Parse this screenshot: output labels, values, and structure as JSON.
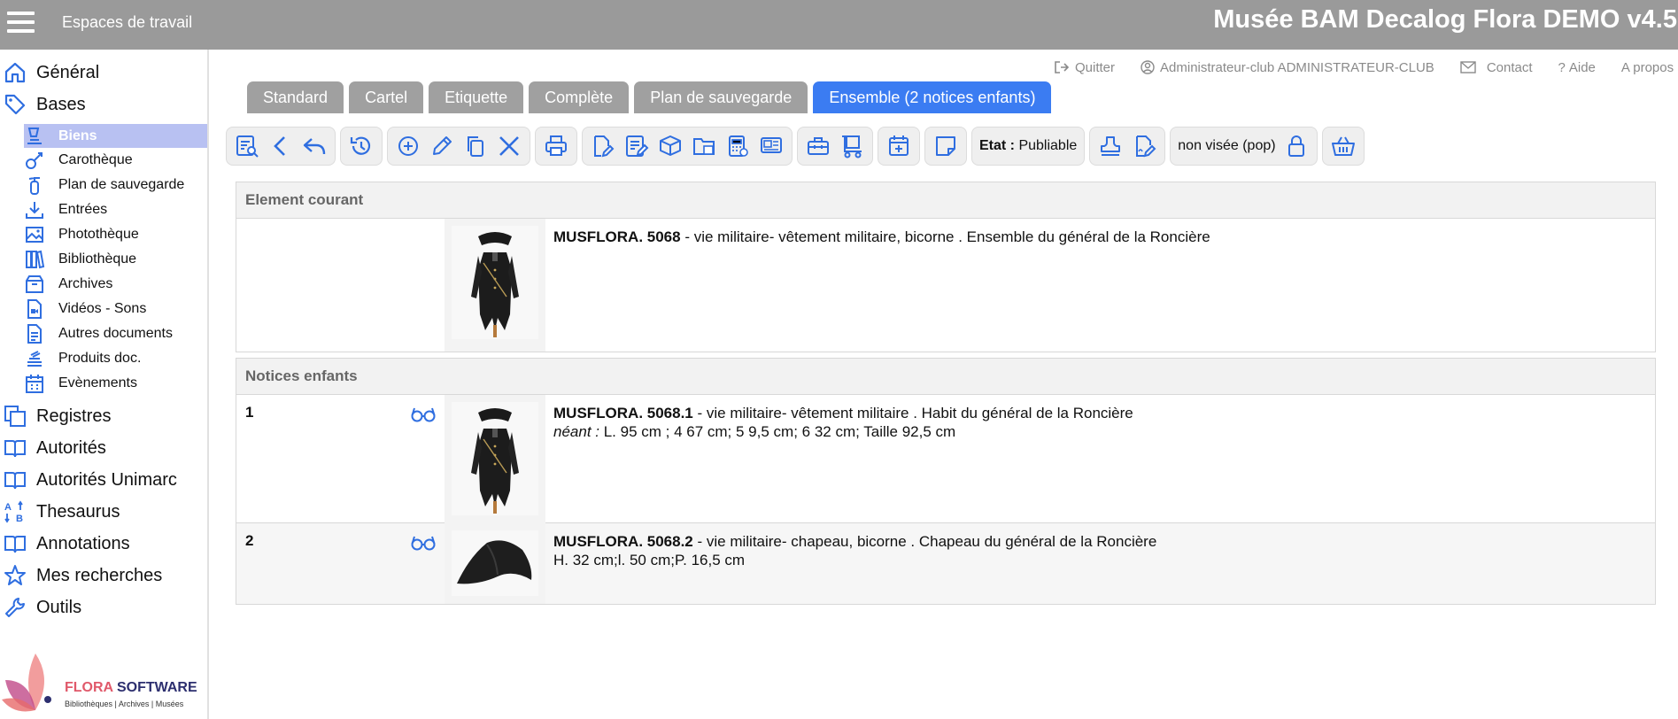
{
  "topbar": {
    "workspaces_label": "Espaces de travail",
    "app_title": "Musée BAM Decalog Flora DEMO v4.5"
  },
  "sidebar": {
    "top_items": [
      {
        "label": "Général",
        "icon": "home-icon"
      },
      {
        "label": "Bases",
        "icon": "tag-icon"
      }
    ],
    "sub_items": [
      {
        "label": "Biens",
        "icon": "biens-icon",
        "active": true
      },
      {
        "label": "Carothèque",
        "icon": "carotheque-icon"
      },
      {
        "label": "Plan de sauvegarde",
        "icon": "extinguisher-icon"
      },
      {
        "label": "Entrées",
        "icon": "download-icon"
      },
      {
        "label": "Photothèque",
        "icon": "images-icon"
      },
      {
        "label": "Bibliothèque",
        "icon": "books-icon"
      },
      {
        "label": "Archives",
        "icon": "archive-box-icon"
      },
      {
        "label": "Vidéos - Sons",
        "icon": "video-file-icon"
      },
      {
        "label": "Autres documents",
        "icon": "document-icon"
      },
      {
        "label": "Produits doc.",
        "icon": "stack-icon"
      },
      {
        "label": "Evènements",
        "icon": "calendar-icon"
      }
    ],
    "bottom_items": [
      {
        "label": "Registres",
        "icon": "registers-icon"
      },
      {
        "label": "Autorités",
        "icon": "book-open-icon"
      },
      {
        "label": "Autorités Unimarc",
        "icon": "book-open-icon"
      },
      {
        "label": "Thesaurus",
        "icon": "sort-az-icon"
      },
      {
        "label": "Annotations",
        "icon": "book-open-icon"
      },
      {
        "label": "Mes recherches",
        "icon": "star-icon"
      },
      {
        "label": "Outils",
        "icon": "wrench-icon"
      }
    ],
    "logo": {
      "brand_part1": "FLORA",
      "brand_part2": "SOFTWARE",
      "tagline": "Bibliothèques | Archives | Musées"
    }
  },
  "header_links": {
    "quit": "Quitter",
    "user": "Administrateur-club ADMINISTRATEUR-CLUB",
    "contact": "Contact",
    "help": "Aide",
    "about": "A propos"
  },
  "tabs": [
    {
      "label": "Standard"
    },
    {
      "label": "Cartel"
    },
    {
      "label": "Etiquette"
    },
    {
      "label": "Complète"
    },
    {
      "label": "Plan de sauvegarde"
    },
    {
      "label": "Ensemble (2 notices enfants)",
      "active": true
    }
  ],
  "toolbar": {
    "etat_label": "Etat :",
    "etat_value": "Publiable",
    "visa_status": "non visée (pop)"
  },
  "current_element": {
    "header": "Element courant",
    "record_id": "MUSFLORA. 5068",
    "description": " - vie militaire- vêtement militaire, bicorne . Ensemble du général de la Roncière"
  },
  "children": {
    "header": "Notices enfants",
    "rows": [
      {
        "num": "1",
        "record_id": "MUSFLORA. 5068.1",
        "description": " - vie militaire- vêtement militaire . Habit du général de la Roncière",
        "dims_label": "néant :",
        "dims": " L. 95 cm ; 4 67 cm; 5 9,5 cm; 6 32 cm; Taille 92,5 cm"
      },
      {
        "num": "2",
        "record_id": "MUSFLORA. 5068.2",
        "description": " - vie militaire- chapeau, bicorne . Chapeau du général de la Roncière",
        "dims": "H. 32 cm;l. 50 cm;P. 16,5 cm"
      }
    ]
  },
  "colors": {
    "topbar": "#9a9a9a",
    "accent": "#3b7cf2",
    "active_nav": "#b8c1f2",
    "icon_blue": "#2f6ee0"
  }
}
